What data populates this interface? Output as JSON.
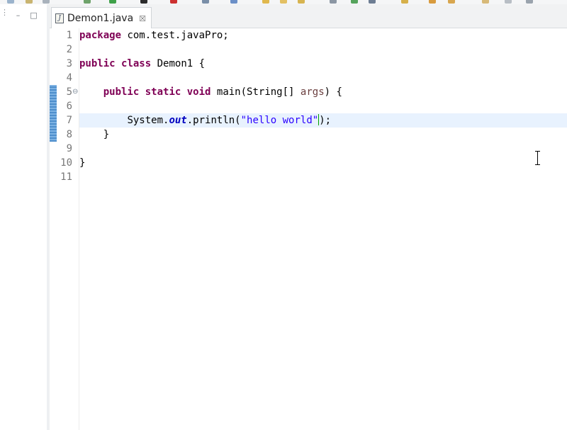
{
  "toolbar": {
    "icons": [
      "run-icon",
      "debug-icon",
      "stop-icon",
      "new-icon",
      "search-icon",
      "open-type-icon",
      "next-annotation-icon"
    ]
  },
  "left_panel": {
    "minimize_label": "–",
    "maximize_label": "□"
  },
  "editor_tab": {
    "icon": "J",
    "label": "Demon1.java",
    "close_label": "☒"
  },
  "editor": {
    "line_numbers": [
      "1",
      "2",
      "3",
      "4",
      "5",
      "6",
      "7",
      "8",
      "9",
      "10",
      "11"
    ],
    "fold_marker": "⊖",
    "lines": {
      "l1": {
        "kw": "package",
        "rest": " com.test.javaPro;"
      },
      "l3": {
        "kw1": "public",
        "kw2": "class",
        "rest": " Demon1 {"
      },
      "l5": {
        "indent": "    ",
        "kw1": "public",
        "kw2": "static",
        "kw3": "void",
        "mid": " main(String[] ",
        "param": "args",
        "rest": ") {"
      },
      "l7": {
        "indent": "        ",
        "pre": "System.",
        "field": "out",
        "mid": ".println(",
        "str": "\"hello world\"",
        "rest": ");"
      },
      "l8": {
        "text": "    }"
      },
      "l10": {
        "text": "}"
      }
    }
  },
  "colors": {
    "keyword": "#7f0055",
    "string": "#2a00ff",
    "field": "#0000c0",
    "current_line": "#e8f2fe",
    "change_bar": "#5f9ed8"
  }
}
